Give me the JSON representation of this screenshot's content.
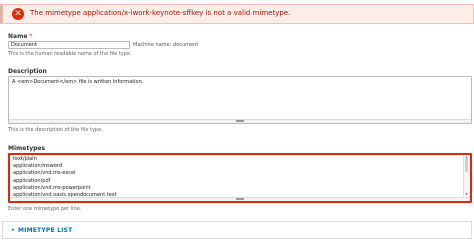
{
  "error": {
    "message": "The mimetype application/x-iwork-keynote-sffkey is not a valid mimetype."
  },
  "name_field": {
    "label": "Name",
    "required_mark": "*",
    "value": "Document",
    "machine_name": "Machine name: document",
    "description": "This is the human readable name of the file type."
  },
  "description_field": {
    "label": "Description",
    "value": "A <em>Document</em> file is written information.",
    "description": "This is the description of the file type."
  },
  "mimetypes_field": {
    "label": "Mimetypes",
    "lines": [
      "text/plain",
      "application/msword",
      "application/vnd.ms-excel",
      "application/pdf",
      "application/vnd.ms-powerpoint",
      "application/vnd.oasis.opendocument.text"
    ],
    "description": "Enter one mimetype per line."
  },
  "details": {
    "arrow": "▸",
    "label": "MIMETYPE LIST"
  },
  "icons": {
    "error": "✕"
  },
  "colors": {
    "error_bg": "#fcede9",
    "error_text": "#a51b00",
    "error_border": "#e62600",
    "link": "#0074bd"
  }
}
